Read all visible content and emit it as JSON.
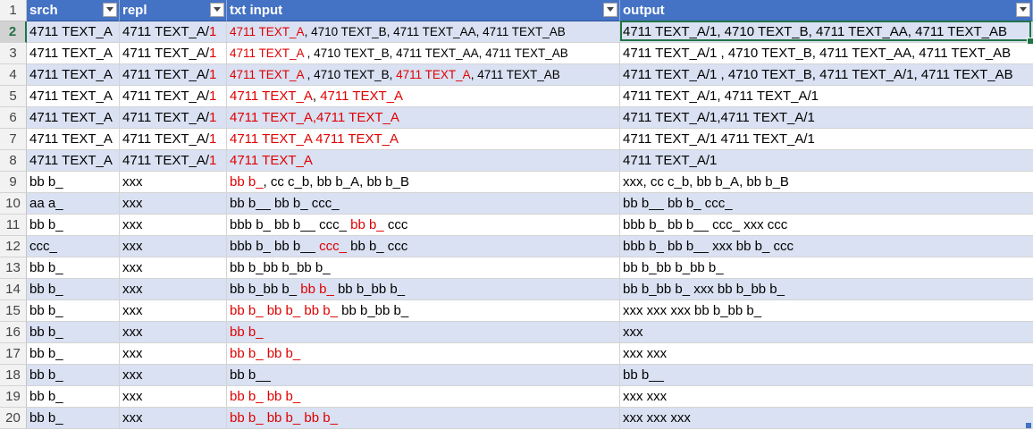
{
  "headers": [
    "srch",
    "repl",
    "txt input",
    "output"
  ],
  "rows": [
    {
      "n": "2",
      "band": true,
      "a": "4711 TEXT_A",
      "b": [
        [
          "4711 TEXT_A/",
          ""
        ],
        [
          "1",
          "red"
        ]
      ],
      "c": [
        [
          "4711 TEXT_A",
          "red"
        ],
        [
          ", 4710 TEXT_B, 4711 TEXT_AA, 4711 TEXT_AB",
          ""
        ]
      ],
      "d": "4711 TEXT_A/1, 4710 TEXT_B, 4711 TEXT_AA, 4711 TEXT_AB"
    },
    {
      "n": "3",
      "band": false,
      "a": "4711 TEXT_A",
      "b": [
        [
          "4711 TEXT_A/",
          ""
        ],
        [
          "1",
          "red"
        ]
      ],
      "c": [
        [
          "4711 TEXT_A ",
          "red"
        ],
        ", 4710 TEXT_B, 4711 TEXT_AA, 4711 TEXT_AB"
      ],
      "d": "4711 TEXT_A/1 , 4710 TEXT_B, 4711 TEXT_AA, 4711 TEXT_AB"
    },
    {
      "n": "4",
      "band": true,
      "a": "4711 TEXT_A",
      "b": [
        [
          "4711 TEXT_A/",
          ""
        ],
        [
          "1",
          "red"
        ]
      ],
      "c": [
        [
          "4711 TEXT_A ",
          "red"
        ],
        ", 4710 TEXT_B, ",
        [
          "4711 TEXT_A",
          "red"
        ],
        ", 4711 TEXT_AB"
      ],
      "d": "4711 TEXT_A/1 , 4710 TEXT_B, 4711 TEXT_A/1, 4711 TEXT_AB"
    },
    {
      "n": "5",
      "band": false,
      "a": "4711 TEXT_A",
      "b": [
        [
          "4711 TEXT_A/",
          ""
        ],
        [
          "1",
          "red"
        ]
      ],
      "c": [
        [
          "4711 TEXT_A",
          "red"
        ],
        ", ",
        [
          "4711 TEXT_A",
          "red"
        ]
      ],
      "d": "4711 TEXT_A/1, 4711 TEXT_A/1"
    },
    {
      "n": "6",
      "band": true,
      "a": "4711 TEXT_A",
      "b": [
        [
          "4711 TEXT_A/",
          ""
        ],
        [
          "1",
          "red"
        ]
      ],
      "c": [
        [
          "4711 TEXT_A,4711 TEXT_A",
          "red"
        ]
      ],
      "d": "4711 TEXT_A/1,4711 TEXT_A/1"
    },
    {
      "n": "7",
      "band": false,
      "a": "4711 TEXT_A",
      "b": [
        [
          "4711 TEXT_A/",
          ""
        ],
        [
          "1",
          "red"
        ]
      ],
      "c": [
        [
          "4711 TEXT_A 4711 TEXT_A",
          "red"
        ]
      ],
      "d": "4711 TEXT_A/1 4711 TEXT_A/1"
    },
    {
      "n": "8",
      "band": true,
      "a": "4711 TEXT_A",
      "b": [
        [
          "4711 TEXT_A/",
          ""
        ],
        [
          "1",
          "red"
        ]
      ],
      "c": [
        [
          "4711 TEXT_A",
          "red"
        ]
      ],
      "d": "4711 TEXT_A/1"
    },
    {
      "n": "9",
      "band": false,
      "a": "bb b_",
      "b": "xxx",
      "c": [
        [
          "bb b_",
          "red"
        ],
        ", cc c_b, bb b_A, bb b_B"
      ],
      "d": "xxx, cc c_b, bb b_A, bb b_B"
    },
    {
      "n": "10",
      "band": true,
      "a": "aa a_",
      "b": "xxx",
      "c": [
        "bb b__ bb b_ ccc_"
      ],
      "d": "bb b__ bb b_ ccc_"
    },
    {
      "n": "11",
      "band": false,
      "a": "bb b_",
      "b": "xxx",
      "c": [
        "bbb b_ bb b__ ccc_ ",
        [
          "bb b_",
          "red"
        ],
        " ccc"
      ],
      "d": "bbb b_ bb b__ ccc_ xxx ccc"
    },
    {
      "n": "12",
      "band": true,
      "a": "ccc_",
      "b": "xxx",
      "c": [
        "bbb b_ bb b__ ",
        [
          "ccc_",
          "red"
        ],
        " bb b_ ccc"
      ],
      "d": "bbb b_ bb b__ xxx bb b_ ccc"
    },
    {
      "n": "13",
      "band": false,
      "a": "bb b_",
      "b": "xxx",
      "c": [
        "bb b_bb b_bb b_"
      ],
      "d": "bb b_bb b_bb b_"
    },
    {
      "n": "14",
      "band": true,
      "a": "bb b_",
      "b": "xxx",
      "c": [
        "bb b_bb b_ ",
        [
          "bb b_",
          "red"
        ],
        " bb b_bb b_"
      ],
      "d": "bb b_bb b_ xxx bb b_bb b_"
    },
    {
      "n": "15",
      "band": false,
      "a": "bb b_",
      "b": "xxx",
      "c": [
        [
          "bb b_ bb b_ bb b_",
          "red"
        ],
        " bb b_bb b_"
      ],
      "d": "xxx xxx xxx bb b_bb b_"
    },
    {
      "n": "16",
      "band": true,
      "a": "bb b_",
      "b": "xxx",
      "c": [
        [
          "bb b_",
          "red"
        ]
      ],
      "d": "xxx"
    },
    {
      "n": "17",
      "band": false,
      "a": "bb b_",
      "b": "xxx",
      "c": [
        [
          "bb b_ bb b_",
          "red"
        ]
      ],
      "d": "xxx xxx"
    },
    {
      "n": "18",
      "band": true,
      "a": "bb b_",
      "b": "xxx",
      "c": [
        "bb b__"
      ],
      "d": "bb b__"
    },
    {
      "n": "19",
      "band": false,
      "a": "bb b_",
      "b": "xxx",
      "c": [
        [
          " bb b_ bb b_",
          "red"
        ]
      ],
      "d": " xxx xxx"
    },
    {
      "n": "20",
      "band": true,
      "a": "bb b_",
      "b": "xxx",
      "c": [
        [
          " bb b_ bb b_ bb b_",
          "red"
        ]
      ],
      "d": " xxx xxx xxx"
    }
  ]
}
